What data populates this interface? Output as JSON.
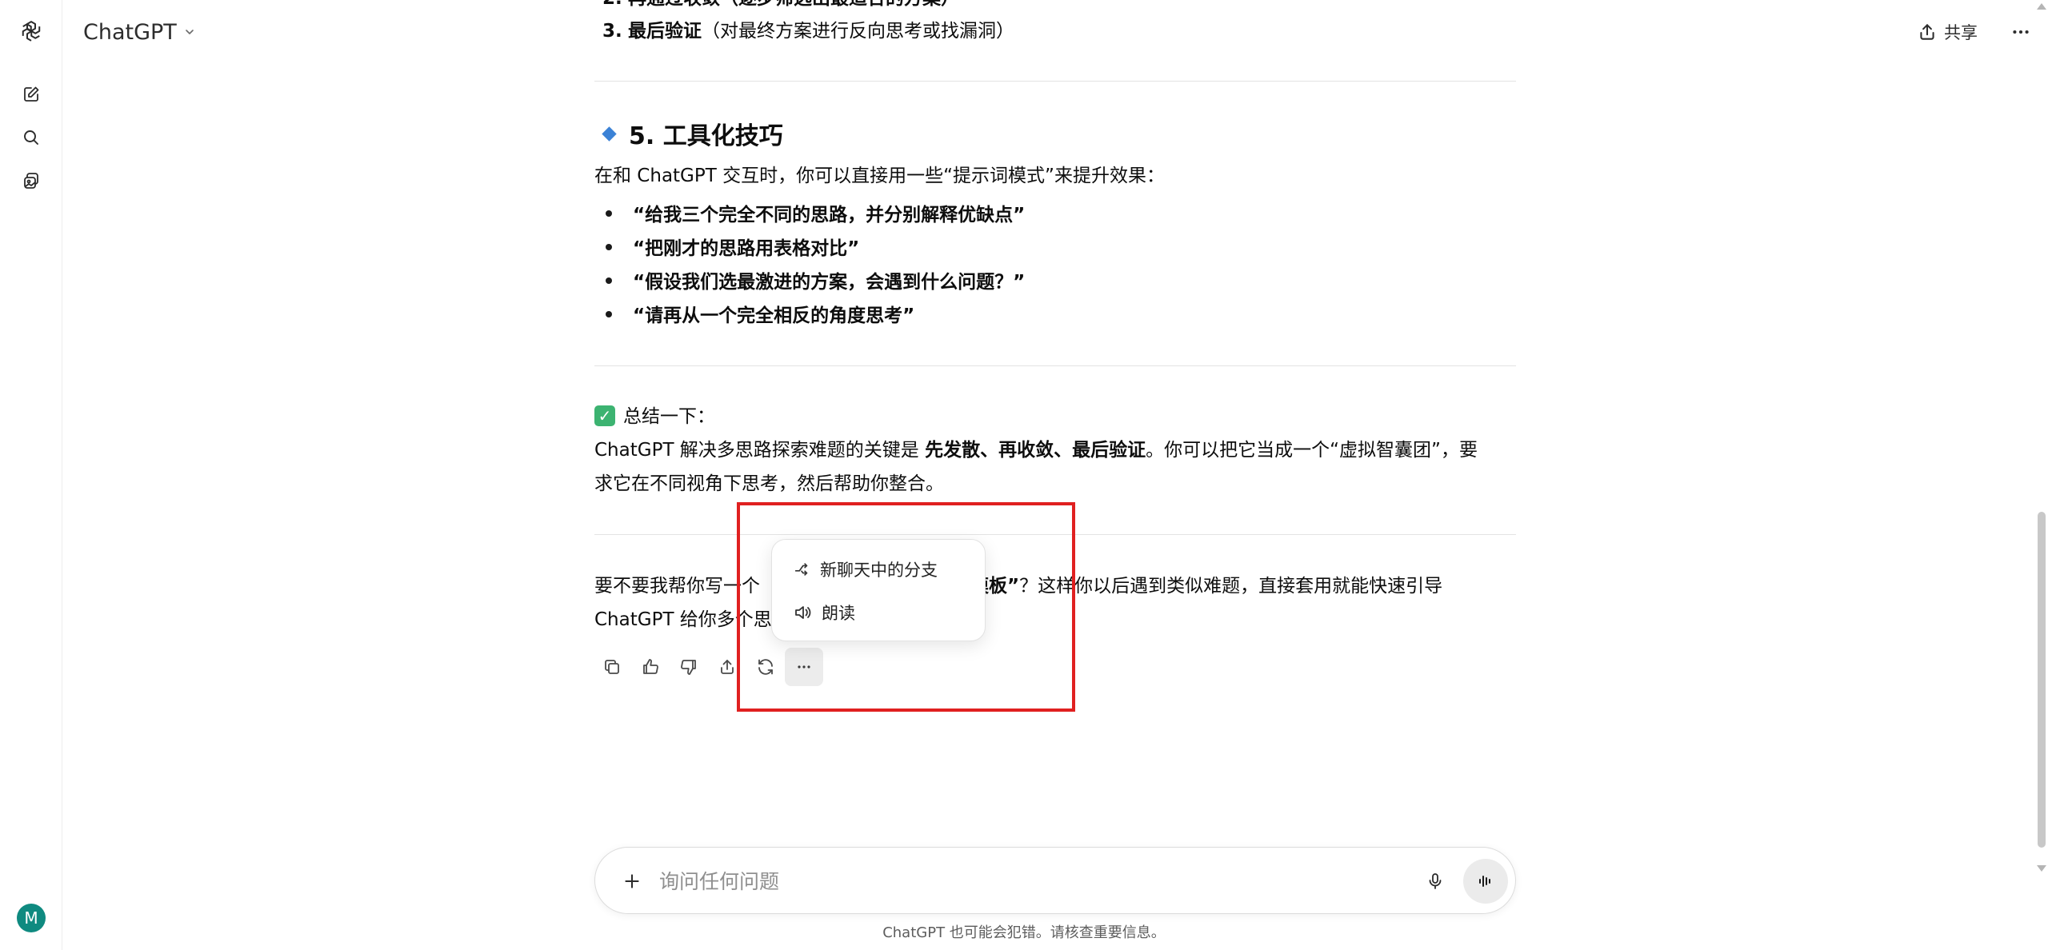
{
  "header": {
    "model_name": "ChatGPT",
    "share_label": "共享"
  },
  "sidebar": {
    "avatar_initial": "M"
  },
  "message": {
    "ol_cut_line": "再通过收敛（逐步筛选出最适合的方案）",
    "ol_item3_num": "3.",
    "ol_item3_bold": "最后验证",
    "ol_item3_text": "（对最终方案进行反向思考或找漏洞）",
    "section5_title": "5. 工具化技巧",
    "section5_intro": "在和 ChatGPT 交互时，你可以直接用一些“提示词模式”来提升效果：",
    "bullets": [
      "“给我三个完全不同的思路，并分别解释优缺点”",
      "“把刚才的思路用表格对比”",
      "“假设我们选最激进的方案，会遇到什么问题？”",
      "“请再从一个完全相反的角度思考”"
    ],
    "summary_label": "总结一下：",
    "summary_p1_a": "ChatGPT 解决多思路探索难题的关键是 ",
    "summary_p1_bold": "先发散、再收敛、最后验证",
    "summary_p1_b": "。你可以把它当成一个“虚拟智囊团”，要",
    "summary_p2": "求它在不同视角下思考，然后帮助你整合。",
    "followup_p1_a": "要不要我帮你写一个",
    "followup_p1_bold": "问模板”",
    "followup_p1_b": "？这样你以后遇到类似难题，直接套用就能快速引导",
    "followup_p2": "ChatGPT 给你多个思"
  },
  "popover_menu": {
    "items": [
      {
        "label": "新聊天中的分支",
        "icon": "branch-icon"
      },
      {
        "label": "朗读",
        "icon": "speaker-icon"
      }
    ]
  },
  "composer": {
    "placeholder": "询问任何问题"
  },
  "footer": {
    "disclaimer": "ChatGPT 也可能会犯错。请核查重要信息。"
  },
  "colors": {
    "highlight": "#e02020",
    "avatar": "#0f8a80",
    "diamond": "#3b82d6",
    "check": "#3cb371"
  }
}
